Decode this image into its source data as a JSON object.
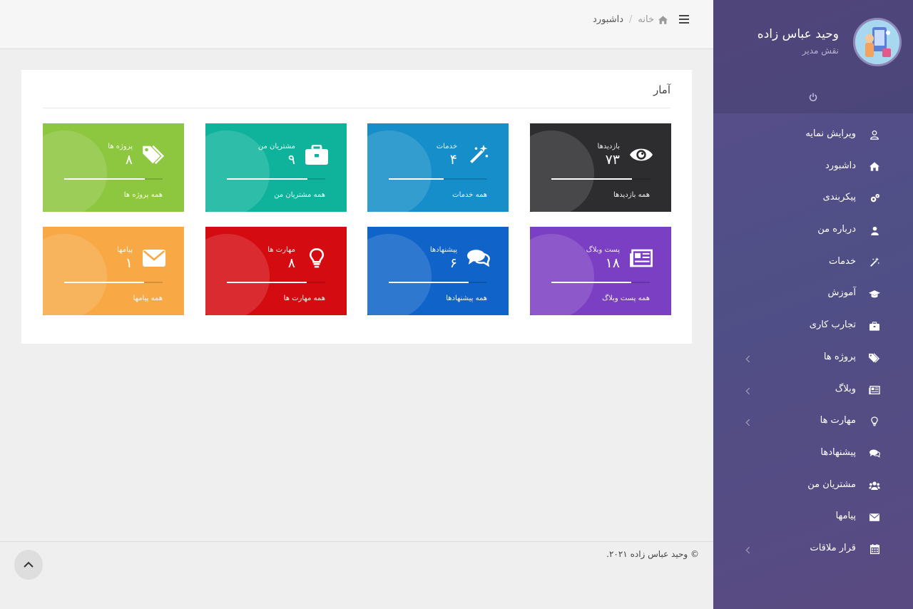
{
  "profile": {
    "name": "وحید عباس زاده",
    "role": "نقش مدیر"
  },
  "menu": [
    {
      "label": "ویرایش نمایه",
      "icon": "user-outline-icon",
      "has_submenu": false
    },
    {
      "label": "داشبورد",
      "icon": "home-icon",
      "has_submenu": false
    },
    {
      "label": "پیکربندی",
      "icon": "gears-icon",
      "has_submenu": false
    },
    {
      "label": "درباره من",
      "icon": "user-icon",
      "has_submenu": false
    },
    {
      "label": "خدمات",
      "icon": "magic-wand-icon",
      "has_submenu": false
    },
    {
      "label": "آموزش",
      "icon": "graduation-cap-icon",
      "has_submenu": false
    },
    {
      "label": "تجارب کاری",
      "icon": "briefcase-icon",
      "has_submenu": false
    },
    {
      "label": "پروژه ها",
      "icon": "tags-icon",
      "has_submenu": true
    },
    {
      "label": "وبلاگ",
      "icon": "newspaper-icon",
      "has_submenu": true
    },
    {
      "label": "مهارت ها",
      "icon": "lightbulb-icon",
      "has_submenu": true
    },
    {
      "label": "پیشنهادها",
      "icon": "comments-icon",
      "has_submenu": false
    },
    {
      "label": "مشتریان من",
      "icon": "users-icon",
      "has_submenu": false
    },
    {
      "label": "پیامها",
      "icon": "envelope-icon",
      "has_submenu": false
    },
    {
      "label": "قرار ملاقات",
      "icon": "calendar-icon",
      "has_submenu": true
    }
  ],
  "header": {
    "breadcrumb_home": "خانه",
    "breadcrumb_separator": "/",
    "breadcrumb_current": "داشبورد"
  },
  "stats": {
    "title": "آمار",
    "tiles": [
      {
        "label": "بازدیدها",
        "value": "۷۳",
        "footer": "همه بازدیدها",
        "icon": "eye-icon",
        "color": "#2d2d2f",
        "progress": 0.82
      },
      {
        "label": "خدمات",
        "value": "۴",
        "footer": "همه خدمات",
        "icon": "magic-wand-icon",
        "color": "#168ec9",
        "progress": 0.56
      },
      {
        "label": "مشتریان من",
        "value": "۹",
        "footer": "همه مشتریان من",
        "icon": "briefcase-icon",
        "color": "#0fb39c",
        "progress": 0.82
      },
      {
        "label": "پروژه ها",
        "value": "۸",
        "footer": "همه پروژه ها",
        "icon": "tags-icon",
        "color": "#8dc63f",
        "progress": 0.82
      },
      {
        "label": "پست وبلاگ",
        "value": "۱۸",
        "footer": "همه پست وبلاگ",
        "icon": "newspaper-icon",
        "color": "#7b3fc3",
        "progress": 0.81
      },
      {
        "label": "پیشنهادها",
        "value": "۶",
        "footer": "همه پیشنهادها",
        "icon": "comments-icon",
        "color": "#1064c9",
        "progress": 0.81
      },
      {
        "label": "مهارت ها",
        "value": "۸",
        "footer": "همه مهارت ها",
        "icon": "lightbulb-icon",
        "color": "#d50b12",
        "progress": 0.81
      },
      {
        "label": "پیامها",
        "value": "۱",
        "footer": "همه پیامها",
        "icon": "envelope-icon",
        "color": "#f8a945",
        "progress": 0.81
      }
    ]
  },
  "footer": {
    "copyright": "© وحید عباس زاده ۲۰۲۱."
  }
}
